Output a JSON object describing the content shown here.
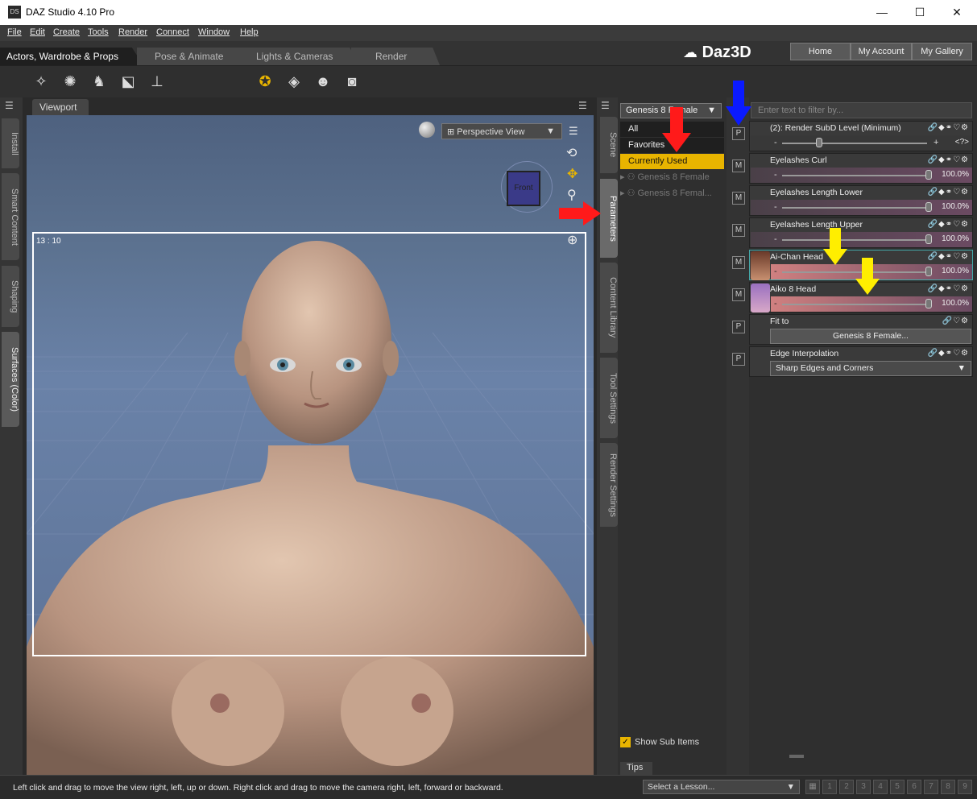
{
  "window": {
    "title": "DAZ Studio 4.10 Pro",
    "logo": "DS",
    "minimize": "—",
    "maximize": "☐",
    "close": "✕"
  },
  "menu": [
    "File",
    "Edit",
    "Create",
    "Tools",
    "Render",
    "Connect",
    "Window",
    "Help"
  ],
  "rooms": [
    "Actors, Wardrobe & Props",
    "Pose & Animate",
    "Lights & Cameras",
    "Render"
  ],
  "brand": "Daz3D",
  "header_buttons": [
    "Home",
    "My Account",
    "My Gallery"
  ],
  "left_tabs": [
    "Install",
    "Smart Content",
    "Shaping",
    "Surfaces (Color)"
  ],
  "viewport": {
    "tab": "Viewport",
    "camera": "Perspective View",
    "frame_counter": "13 : 10",
    "cube_label": "Front"
  },
  "mid_tabs": [
    "Scene",
    "Parameters",
    "Content Library",
    "Tool Settings",
    "Render Settings"
  ],
  "scene": {
    "figure_select": "Genesis 8 Female",
    "categories": [
      "All",
      "Favorites",
      "Currently Used"
    ],
    "tree": [
      "Genesis 8 Female",
      "Genesis 8 Femal..."
    ],
    "show_sub_items": "Show Sub Items"
  },
  "params": {
    "filter_placeholder": "Enter text to filter by...",
    "rows": [
      {
        "badge": "P",
        "label": "(2): Render SubD Level (Minimum)",
        "value": "<?>"
      },
      {
        "badge": "M",
        "label": "Eyelashes Curl",
        "value": "100.0%"
      },
      {
        "badge": "M",
        "label": "Eyelashes Length Lower",
        "value": "100.0%"
      },
      {
        "badge": "M",
        "label": "Eyelashes Length Upper",
        "value": "100.0%"
      },
      {
        "badge": "M",
        "label": "Ai-Chan Head",
        "value": "100.0%"
      },
      {
        "badge": "M",
        "label": "Aiko 8 Head",
        "value": "100.0%"
      },
      {
        "badge": "P",
        "label": "Fit to",
        "value": "Genesis 8 Female..."
      },
      {
        "badge": "P",
        "label": "Edge Interpolation",
        "value": "Sharp Edges and Corners"
      }
    ]
  },
  "tips_tab": "Tips",
  "status": {
    "message": "Left click and drag to move the view right, left, up or down. Right click and drag to move the camera right, left, forward or backward.",
    "lesson": "Select a Lesson...",
    "pages": [
      "1",
      "2",
      "3",
      "4",
      "5",
      "6",
      "7",
      "8",
      "9"
    ]
  },
  "colors": {
    "accent": "#e8b400",
    "red_arrow": "#ff1a1a",
    "blue_arrow": "#0a1aff",
    "yellow_arrow": "#ffee00"
  }
}
